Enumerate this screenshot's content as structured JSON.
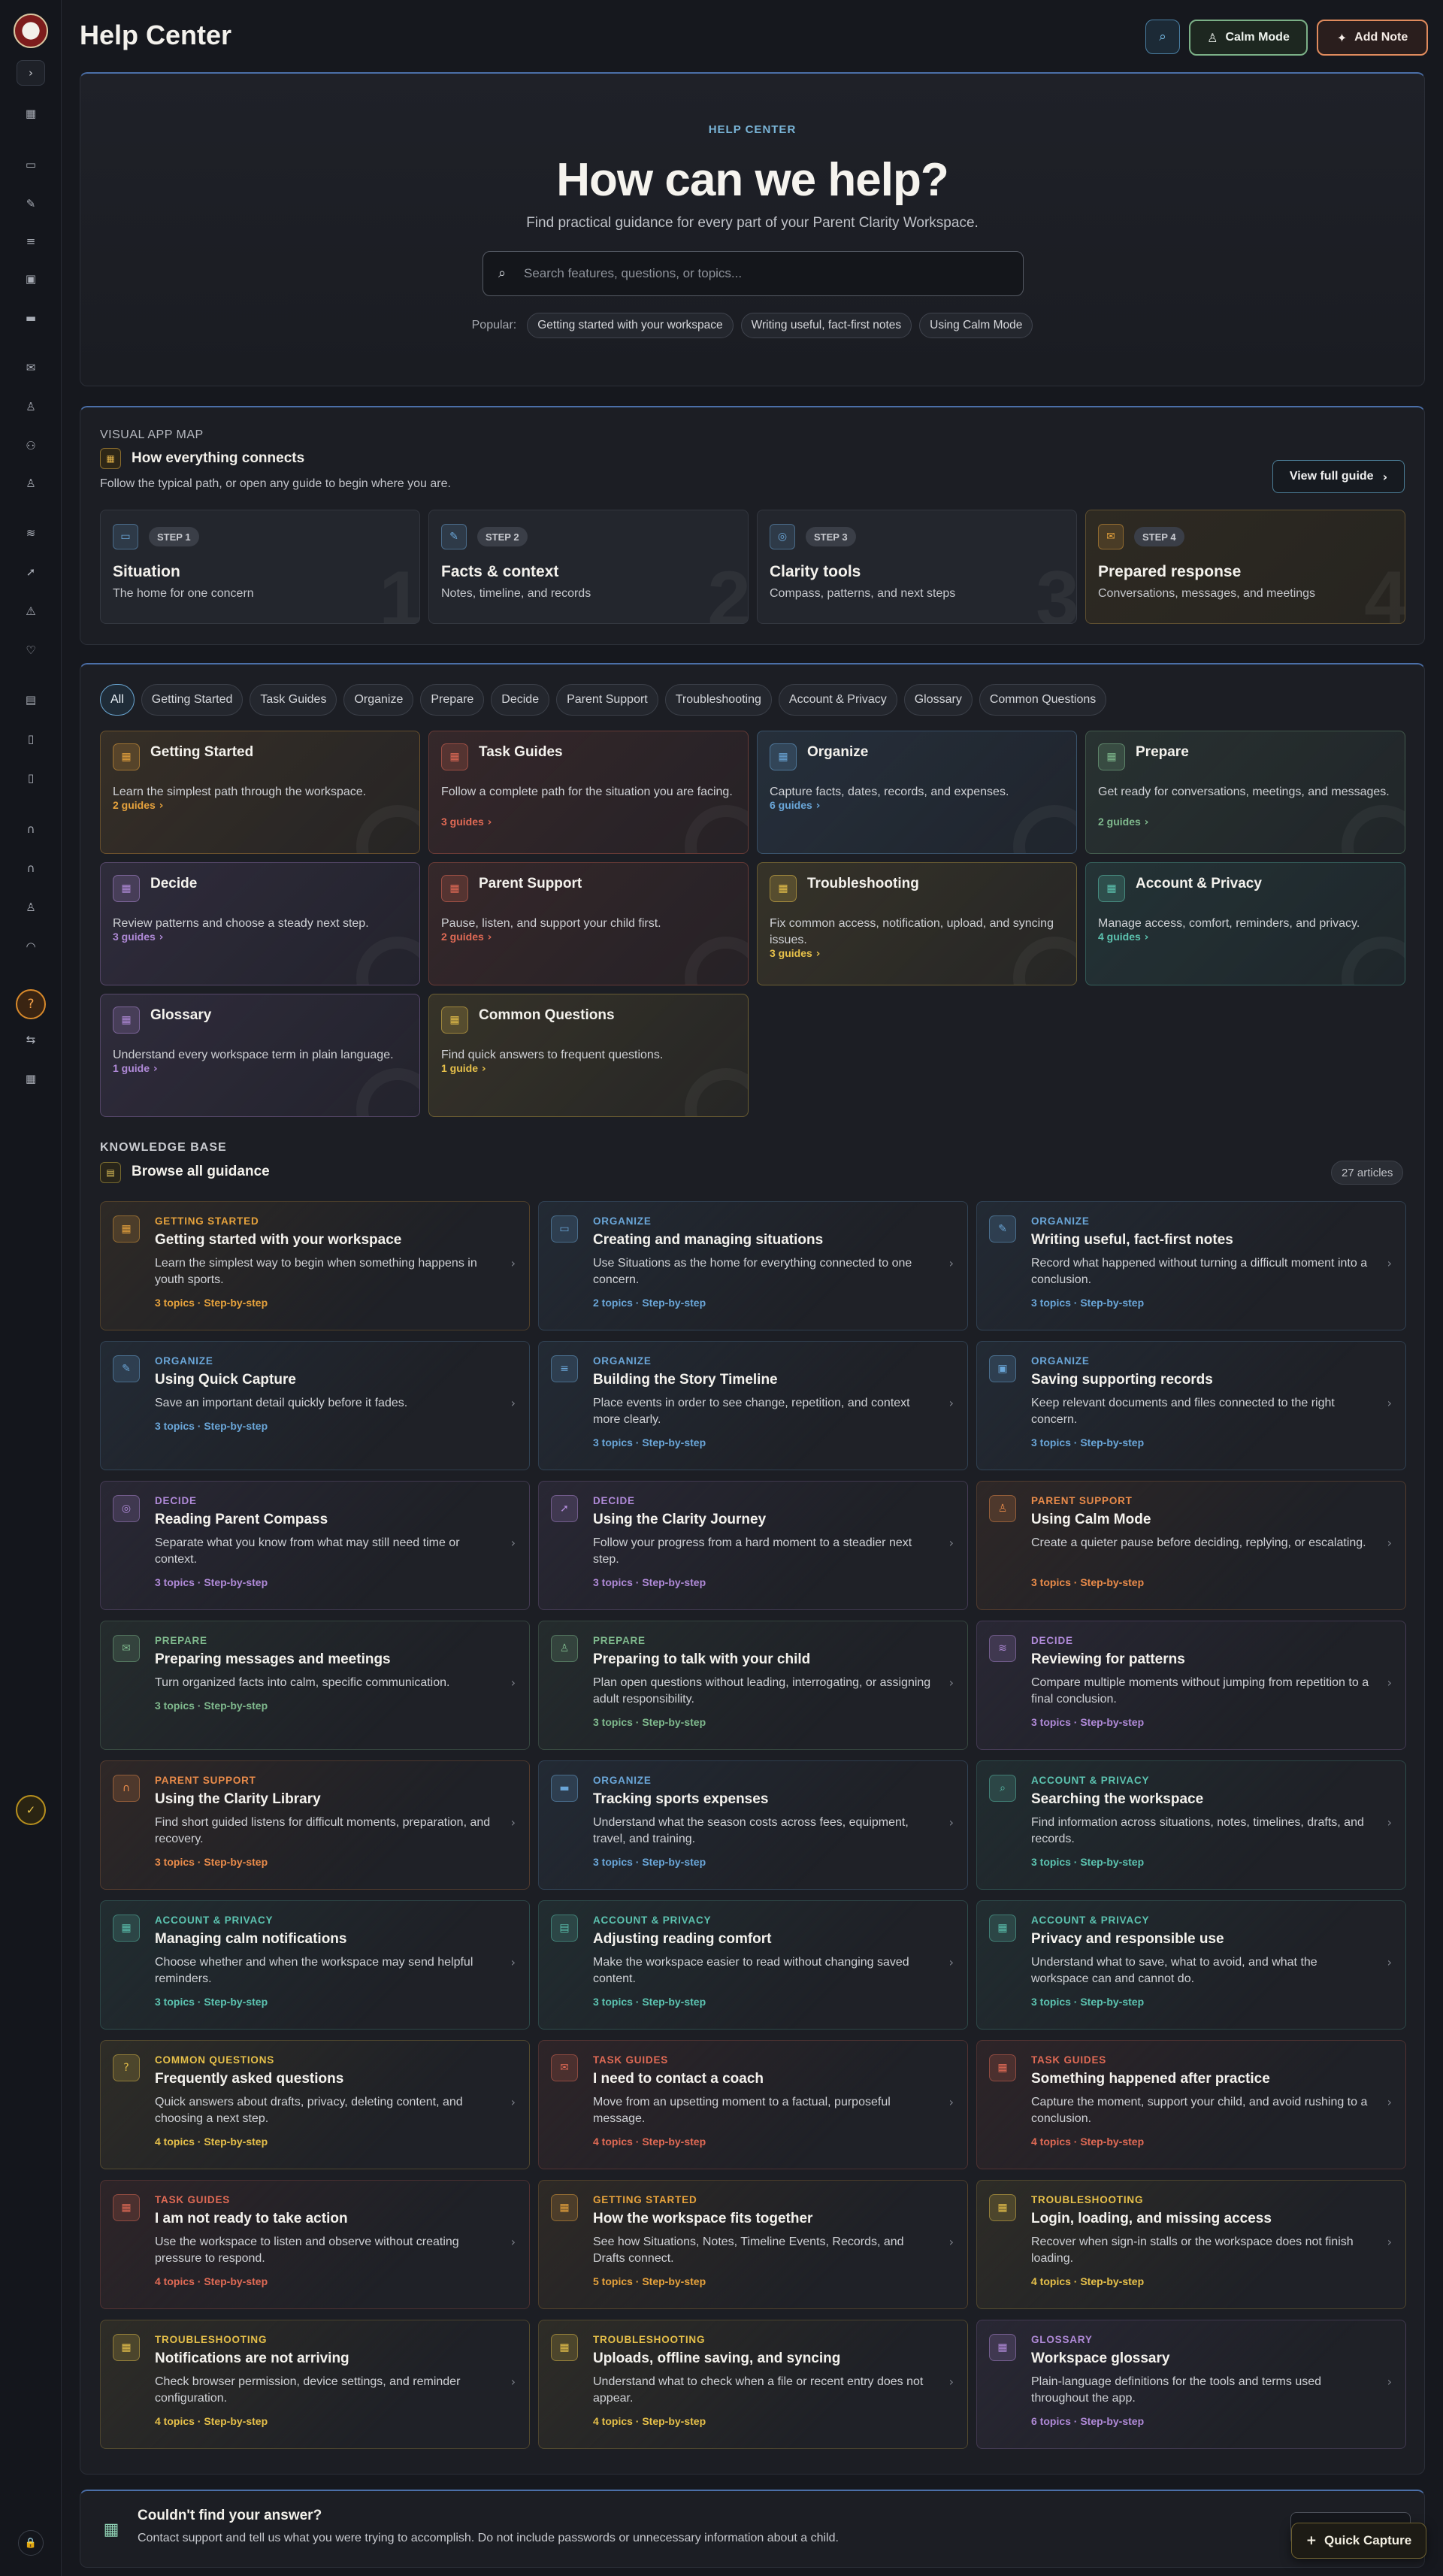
{
  "colors": {
    "amber": "#e6a23c",
    "red": "#e06a55",
    "blue": "#6aa6d8",
    "green": "#7fb98d",
    "purple": "#b08ad8",
    "yellow": "#e6c04a",
    "teal": "#5cc3b0",
    "orange": "#e98b4a"
  },
  "sidebar": {
    "logo": "logo",
    "toggle_icon": "chevron-right-icon",
    "icons": [
      "grid-icon",
      "folder-icon",
      "note-icon",
      "timeline-icon",
      "calendar-icon",
      "card-icon",
      "mail-icon",
      "person-icon",
      "people-icon",
      "figure-icon",
      "pattern-icon",
      "journey-icon",
      "alert-icon",
      "heart-icon",
      "document-icon",
      "file-icon",
      "file-icon",
      "headphones-icon",
      "headphones-icon",
      "figure-icon",
      "feed-icon",
      "help-icon",
      "settings-icon",
      "grid-icon",
      "check-icon",
      "lock-icon"
    ]
  },
  "header": {
    "title": "Help Center",
    "calm_mode": "Calm Mode",
    "add_note": "Add Note"
  },
  "hero": {
    "eyebrow": "HELP CENTER",
    "title": "How can we help?",
    "subtitle": "Find practical guidance for every part of your Parent Clarity Workspace.",
    "search_placeholder": "Search features, questions, or topics...",
    "popular_label": "Popular:",
    "popular": [
      "Getting started with your workspace",
      "Writing useful, fact-first notes",
      "Using Calm Mode"
    ]
  },
  "app_map": {
    "eyebrow": "VISUAL APP MAP",
    "title": "How everything connects",
    "subtitle": "Follow the typical path, or open any guide to begin where you are.",
    "full_guide": "View full guide",
    "steps": [
      {
        "badge": "STEP 1",
        "title": "Situation",
        "subtitle": "The home for one concern",
        "num": "1",
        "icon": "folder-icon",
        "color": "blue"
      },
      {
        "badge": "STEP 2",
        "title": "Facts & context",
        "subtitle": "Notes, timeline, and records",
        "num": "2",
        "icon": "note-icon",
        "color": "blue"
      },
      {
        "badge": "STEP 3",
        "title": "Clarity tools",
        "subtitle": "Compass, patterns, and next steps",
        "num": "3",
        "icon": "compass-icon",
        "color": "blue"
      },
      {
        "badge": "STEP 4",
        "title": "Prepared response",
        "subtitle": "Conversations, messages, and meetings",
        "num": "4",
        "icon": "mail-icon",
        "color": "amber"
      }
    ]
  },
  "filters": [
    "All",
    "Getting Started",
    "Task Guides",
    "Organize",
    "Prepare",
    "Decide",
    "Parent Support",
    "Troubleshooting",
    "Account & Privacy",
    "Glossary",
    "Common Questions"
  ],
  "categories": [
    {
      "title": "Getting Started",
      "desc": "Learn the simplest path through the workspace.",
      "count": "2 guides",
      "color": "amber"
    },
    {
      "title": "Task Guides",
      "desc": "Follow a complete path for the situation you are facing.",
      "count": "3 guides",
      "color": "red"
    },
    {
      "title": "Organize",
      "desc": "Capture facts, dates, records, and expenses.",
      "count": "6 guides",
      "color": "blue"
    },
    {
      "title": "Prepare",
      "desc": "Get ready for conversations, meetings, and messages.",
      "count": "2 guides",
      "color": "green"
    },
    {
      "title": "Decide",
      "desc": "Review patterns and choose a steady next step.",
      "count": "3 guides",
      "color": "purple"
    },
    {
      "title": "Parent Support",
      "desc": "Pause, listen, and support your child first.",
      "count": "2 guides",
      "color": "red"
    },
    {
      "title": "Troubleshooting",
      "desc": "Fix common access, notification, upload, and syncing issues.",
      "count": "3 guides",
      "color": "yellow"
    },
    {
      "title": "Account & Privacy",
      "desc": "Manage access, comfort, reminders, and privacy.",
      "count": "4 guides",
      "color": "teal"
    },
    {
      "title": "Glossary",
      "desc": "Understand every workspace term in plain language.",
      "count": "1 guide",
      "color": "purple"
    },
    {
      "title": "Common Questions",
      "desc": "Find quick answers to frequent questions.",
      "count": "1 guide",
      "color": "yellow"
    }
  ],
  "knowledge_base": {
    "eyebrow": "KNOWLEDGE BASE",
    "title": "Browse all guidance",
    "count": "27 articles",
    "articles": [
      {
        "cat": "GETTING STARTED",
        "title": "Getting started with your workspace",
        "desc": "Learn the simplest way to begin when something happens in youth sports.",
        "meta": "3 topics · Step-by-step",
        "color": "amber",
        "icon": "grid-icon"
      },
      {
        "cat": "ORGANIZE",
        "title": "Creating and managing situations",
        "desc": "Use Situations as the home for everything connected to one concern.",
        "meta": "2 topics · Step-by-step",
        "color": "blue",
        "icon": "folder-icon"
      },
      {
        "cat": "ORGANIZE",
        "title": "Writing useful, fact-first notes",
        "desc": "Record what happened without turning a difficult moment into a conclusion.",
        "meta": "3 topics · Step-by-step",
        "color": "blue",
        "icon": "note-icon"
      },
      {
        "cat": "ORGANIZE",
        "title": "Using Quick Capture",
        "desc": "Save an important detail quickly before it fades.",
        "meta": "3 topics · Step-by-step",
        "color": "blue",
        "icon": "note-icon"
      },
      {
        "cat": "ORGANIZE",
        "title": "Building the Story Timeline",
        "desc": "Place events in order to see change, repetition, and context more clearly.",
        "meta": "3 topics · Step-by-step",
        "color": "blue",
        "icon": "timeline-icon"
      },
      {
        "cat": "ORGANIZE",
        "title": "Saving supporting records",
        "desc": "Keep relevant documents and files connected to the right concern.",
        "meta": "3 topics · Step-by-step",
        "color": "blue",
        "icon": "calendar-icon"
      },
      {
        "cat": "DECIDE",
        "title": "Reading Parent Compass",
        "desc": "Separate what you know from what may still need time or context.",
        "meta": "3 topics · Step-by-step",
        "color": "purple",
        "icon": "compass-icon"
      },
      {
        "cat": "DECIDE",
        "title": "Using the Clarity Journey",
        "desc": "Follow your progress from a hard moment to a steadier next step.",
        "meta": "3 topics · Step-by-step",
        "color": "purple",
        "icon": "journey-icon"
      },
      {
        "cat": "PARENT SUPPORT",
        "title": "Using Calm Mode",
        "desc": "Create a quieter pause before deciding, replying, or escalating.",
        "meta": "3 topics · Step-by-step",
        "color": "orange",
        "icon": "figure-icon"
      },
      {
        "cat": "PREPARE",
        "title": "Preparing messages and meetings",
        "desc": "Turn organized facts into calm, specific communication.",
        "meta": "3 topics · Step-by-step",
        "color": "green",
        "icon": "mail-icon"
      },
      {
        "cat": "PREPARE",
        "title": "Preparing to talk with your child",
        "desc": "Plan open questions without leading, interrogating, or assigning adult responsibility.",
        "meta": "3 topics · Step-by-step",
        "color": "green",
        "icon": "person-icon"
      },
      {
        "cat": "DECIDE",
        "title": "Reviewing for patterns",
        "desc": "Compare multiple moments without jumping from repetition to a final conclusion.",
        "meta": "3 topics · Step-by-step",
        "color": "purple",
        "icon": "pattern-icon"
      },
      {
        "cat": "PARENT SUPPORT",
        "title": "Using the Clarity Library",
        "desc": "Find short guided listens for difficult moments, preparation, and recovery.",
        "meta": "3 topics · Step-by-step",
        "color": "orange",
        "icon": "headphones-icon"
      },
      {
        "cat": "ORGANIZE",
        "title": "Tracking sports expenses",
        "desc": "Understand what the season costs across fees, equipment, travel, and training.",
        "meta": "3 topics · Step-by-step",
        "color": "blue",
        "icon": "card-icon"
      },
      {
        "cat": "ACCOUNT & PRIVACY",
        "title": "Searching the workspace",
        "desc": "Find information across situations, notes, timelines, drafts, and records.",
        "meta": "3 topics · Step-by-step",
        "color": "teal",
        "icon": "search-icon"
      },
      {
        "cat": "ACCOUNT & PRIVACY",
        "title": "Managing calm notifications",
        "desc": "Choose whether and when the workspace may send helpful reminders.",
        "meta": "3 topics · Step-by-step",
        "color": "teal",
        "icon": "grid-icon"
      },
      {
        "cat": "ACCOUNT & PRIVACY",
        "title": "Adjusting reading comfort",
        "desc": "Make the workspace easier to read without changing saved content.",
        "meta": "3 topics · Step-by-step",
        "color": "teal",
        "icon": "document-icon"
      },
      {
        "cat": "ACCOUNT & PRIVACY",
        "title": "Privacy and responsible use",
        "desc": "Understand what to save, what to avoid, and what the workspace can and cannot do.",
        "meta": "3 topics · Step-by-step",
        "color": "teal",
        "icon": "grid-icon"
      },
      {
        "cat": "COMMON QUESTIONS",
        "title": "Frequently asked questions",
        "desc": "Quick answers about drafts, privacy, deleting content, and choosing a next step.",
        "meta": "4 topics · Step-by-step",
        "color": "yellow",
        "icon": "help-icon"
      },
      {
        "cat": "TASK GUIDES",
        "title": "I need to contact a coach",
        "desc": "Move from an upsetting moment to a factual, purposeful message.",
        "meta": "4 topics · Step-by-step",
        "color": "red",
        "icon": "mail-icon"
      },
      {
        "cat": "TASK GUIDES",
        "title": "Something happened after practice",
        "desc": "Capture the moment, support your child, and avoid rushing to a conclusion.",
        "meta": "4 topics · Step-by-step",
        "color": "red",
        "icon": "grid-icon"
      },
      {
        "cat": "TASK GUIDES",
        "title": "I am not ready to take action",
        "desc": "Use the workspace to listen and observe without creating pressure to respond.",
        "meta": "4 topics · Step-by-step",
        "color": "red",
        "icon": "grid-icon"
      },
      {
        "cat": "GETTING STARTED",
        "title": "How the workspace fits together",
        "desc": "See how Situations, Notes, Timeline Events, Records, and Drafts connect.",
        "meta": "5 topics · Step-by-step",
        "color": "amber",
        "icon": "grid-icon"
      },
      {
        "cat": "TROUBLESHOOTING",
        "title": "Login, loading, and missing access",
        "desc": "Recover when sign-in stalls or the workspace does not finish loading.",
        "meta": "4 topics · Step-by-step",
        "color": "yellow",
        "icon": "grid-icon"
      },
      {
        "cat": "TROUBLESHOOTING",
        "title": "Notifications are not arriving",
        "desc": "Check browser permission, device settings, and reminder configuration.",
        "meta": "4 topics · Step-by-step",
        "color": "yellow",
        "icon": "grid-icon"
      },
      {
        "cat": "TROUBLESHOOTING",
        "title": "Uploads, offline saving, and syncing",
        "desc": "Understand what to check when a file or recent entry does not appear.",
        "meta": "4 topics · Step-by-step",
        "color": "yellow",
        "icon": "grid-icon"
      },
      {
        "cat": "GLOSSARY",
        "title": "Workspace glossary",
        "desc": "Plain-language definitions for the tools and terms used throughout the app.",
        "meta": "6 topics · Step-by-step",
        "color": "purple",
        "icon": "grid-icon"
      }
    ]
  },
  "footer": {
    "title": "Couldn't find your answer?",
    "subtitle": "Contact support and tell us what you were trying to accomplish. Do not include passwords or unnecessary information about a child.",
    "button": "Contact support"
  },
  "quick_capture": "Quick Capture"
}
